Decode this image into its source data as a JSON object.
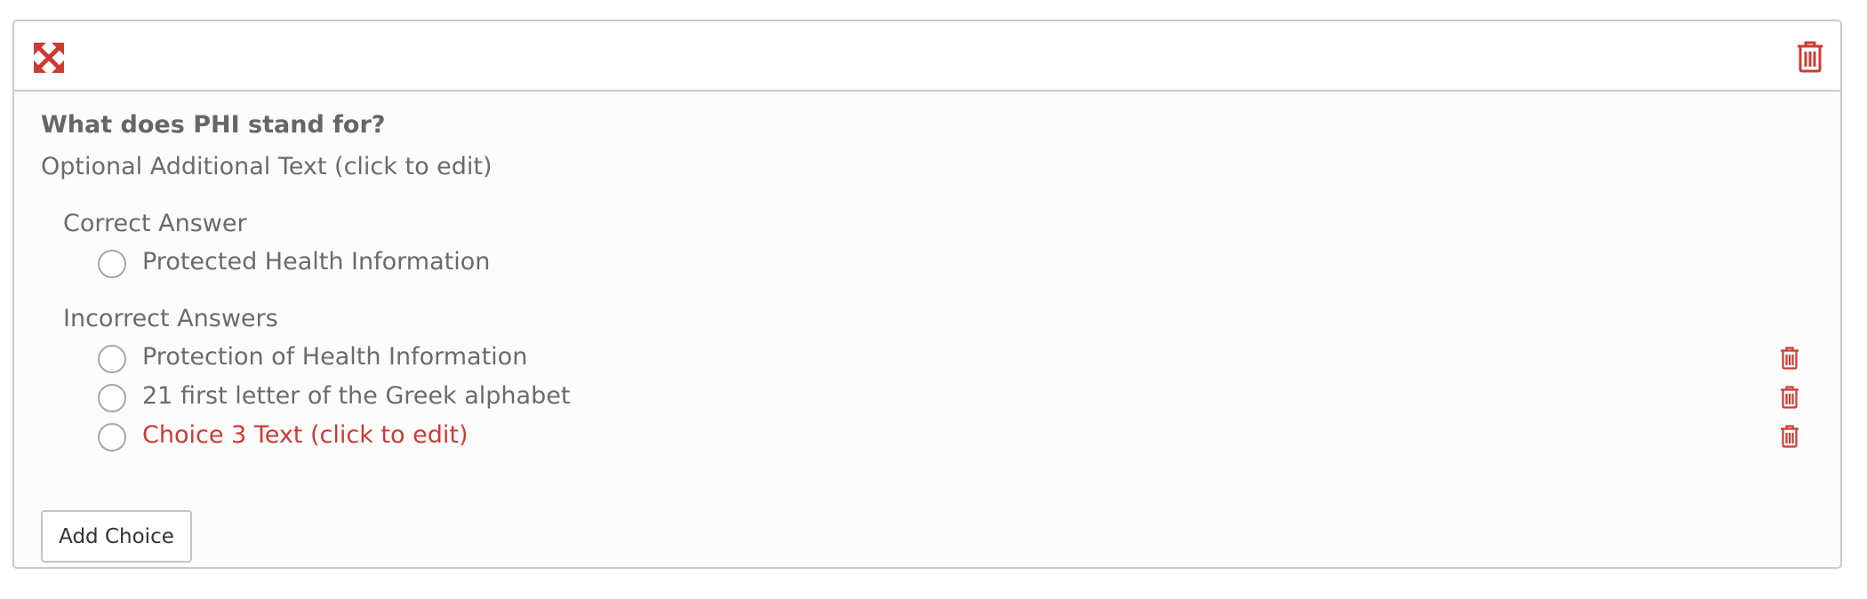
{
  "question": {
    "title": "What does PHI stand for?",
    "additional_text": "Optional Additional Text (click to edit)"
  },
  "correct_section": {
    "label": "Correct Answer",
    "choices": [
      {
        "text": "Protected Health Information"
      }
    ]
  },
  "incorrect_section": {
    "label": "Incorrect Answers",
    "choices": [
      {
        "text": "Protection of Health Information"
      },
      {
        "text": "21 first letter of the Greek alphabet"
      },
      {
        "text": "Choice 3 Text (click to edit)"
      }
    ]
  },
  "add_choice_label": "Add Choice",
  "icons": {
    "expand": "expand-arrows-icon",
    "delete": "trash-icon"
  },
  "colors": {
    "accent_red": "#cc3b33",
    "text_gray": "#6b6b6b",
    "border_gray": "#c9c9c9"
  }
}
